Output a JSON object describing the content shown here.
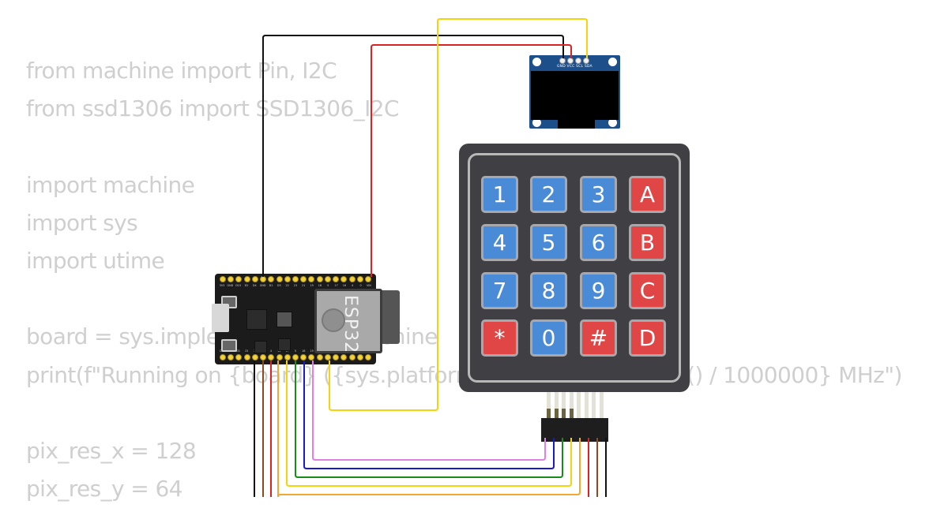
{
  "code": {
    "lines": [
      "from machine import Pin, I2C",
      "from ssd1306 import SSD1306_I2C",
      "",
      "import machine",
      "import sys",
      "import utime",
      "",
      "board = sys.implementation._machine",
      "print(f\"Running on {board} ({sys.platform}) at {machine.freq() / 1000000} MHz\")",
      "",
      "pix_res_x = 128",
      "pix_res_y = 64"
    ]
  },
  "esp32": {
    "label": "ESP32",
    "top_pins": [
      "3V3",
      "GND",
      "D15",
      "D2",
      "D4",
      "GND",
      "D1",
      "D3",
      "22",
      "23",
      "21",
      "19",
      "18",
      "5",
      "17",
      "16",
      "4",
      "0",
      "VIN"
    ],
    "bottom_pins": [
      "CLK",
      "D0",
      "D1",
      "15",
      "2",
      "0",
      "4",
      "16",
      "17",
      "5",
      "18",
      "19",
      "GND",
      "21",
      "RX",
      "TX",
      "22",
      "23",
      "GND"
    ]
  },
  "oled": {
    "pin_labels": "GND VCC SCL SDA"
  },
  "keypad": {
    "rows": [
      [
        {
          "label": "1",
          "color": "blue"
        },
        {
          "label": "2",
          "color": "blue"
        },
        {
          "label": "3",
          "color": "blue"
        },
        {
          "label": "A",
          "color": "red"
        }
      ],
      [
        {
          "label": "4",
          "color": "blue"
        },
        {
          "label": "5",
          "color": "blue"
        },
        {
          "label": "6",
          "color": "blue"
        },
        {
          "label": "B",
          "color": "red"
        }
      ],
      [
        {
          "label": "7",
          "color": "blue"
        },
        {
          "label": "8",
          "color": "blue"
        },
        {
          "label": "9",
          "color": "blue"
        },
        {
          "label": "C",
          "color": "red"
        }
      ],
      [
        {
          "label": "*",
          "color": "red"
        },
        {
          "label": "0",
          "color": "blue"
        },
        {
          "label": "#",
          "color": "red"
        },
        {
          "label": "D",
          "color": "red"
        }
      ]
    ]
  },
  "colors": {
    "key_blue": "#4a8bd7",
    "key_red": "#e04646",
    "wire_black": "#111111",
    "wire_red": "#dd2222",
    "wire_yellow": "#f5d40f",
    "wire_orange": "#f0a830",
    "wire_brown": "#8b4a20",
    "wire_green": "#1a8a1a",
    "wire_blue": "#1a1acc",
    "wire_violet": "#e080e0"
  }
}
